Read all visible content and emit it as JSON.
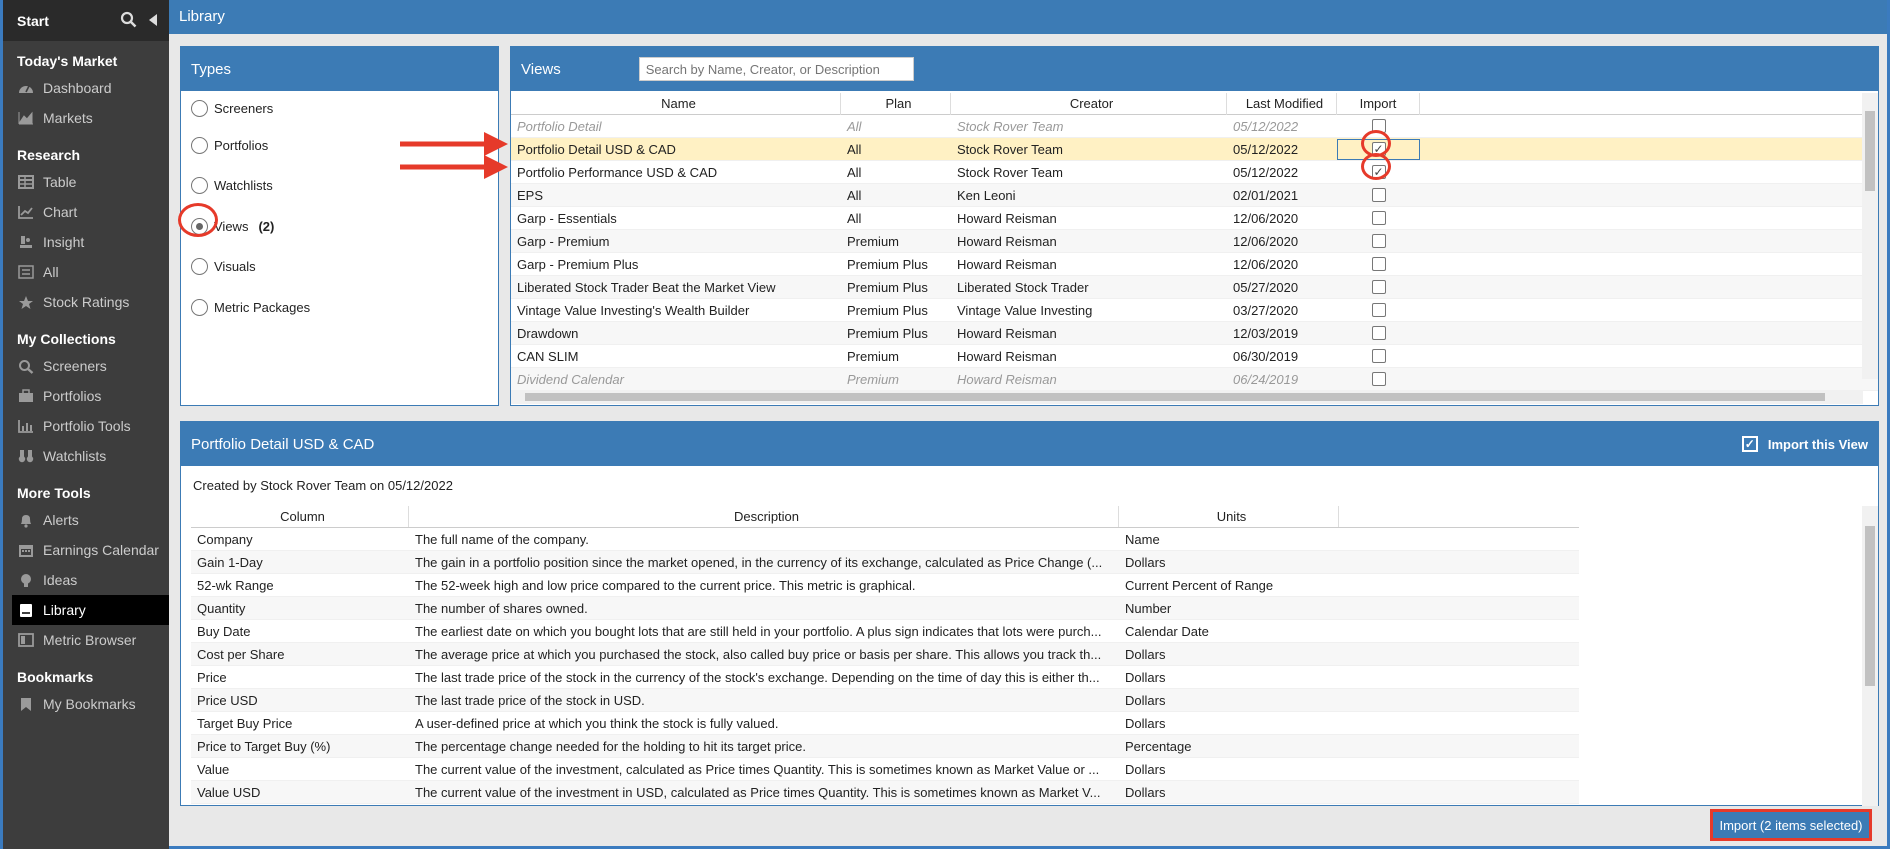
{
  "sidebar": {
    "start_label": "Start",
    "sections": [
      {
        "title": "Today's Market",
        "items": [
          {
            "label": "Dashboard",
            "icon": "dashboard-icon"
          },
          {
            "label": "Markets",
            "icon": "markets-icon"
          }
        ]
      },
      {
        "title": "Research",
        "items": [
          {
            "label": "Table",
            "icon": "table-icon"
          },
          {
            "label": "Chart",
            "icon": "chart-icon"
          },
          {
            "label": "Insight",
            "icon": "insight-icon"
          },
          {
            "label": "All",
            "icon": "all-icon"
          },
          {
            "label": "Stock Ratings",
            "icon": "star-icon"
          }
        ]
      },
      {
        "title": "My Collections",
        "items": [
          {
            "label": "Screeners",
            "icon": "search-icon"
          },
          {
            "label": "Portfolios",
            "icon": "portfolio-icon"
          },
          {
            "label": "Portfolio Tools",
            "icon": "tools-icon"
          },
          {
            "label": "Watchlists",
            "icon": "binoculars-icon"
          }
        ]
      },
      {
        "title": "More Tools",
        "items": [
          {
            "label": "Alerts",
            "icon": "bell-icon"
          },
          {
            "label": "Earnings Calendar",
            "icon": "calendar-icon"
          },
          {
            "label": "Ideas",
            "icon": "lightbulb-icon"
          },
          {
            "label": "Library",
            "icon": "library-icon",
            "active": true
          },
          {
            "label": "Metric Browser",
            "icon": "metric-icon"
          }
        ]
      },
      {
        "title": "Bookmarks",
        "items": [
          {
            "label": "My Bookmarks",
            "icon": "bookmark-icon"
          }
        ]
      }
    ]
  },
  "topbar": {
    "title": "Library"
  },
  "types": {
    "title": "Types",
    "items": [
      {
        "label": "Screeners",
        "count": ""
      },
      {
        "label": "Portfolios",
        "count": ""
      },
      {
        "label": "Watchlists",
        "count": ""
      },
      {
        "label": "Views",
        "count": "(2)",
        "selected": true
      },
      {
        "label": "Visuals",
        "count": ""
      },
      {
        "label": "Metric Packages",
        "count": ""
      }
    ]
  },
  "views": {
    "title": "Views",
    "search_placeholder": "Search by Name, Creator, or Description",
    "columns": [
      "Name",
      "Plan",
      "Creator",
      "Last Modified",
      "Import"
    ],
    "rows": [
      {
        "name": "Portfolio Detail",
        "plan": "All",
        "creator": "Stock Rover Team",
        "modified": "05/12/2022",
        "checked": false,
        "dim": true
      },
      {
        "name": "Portfolio Detail USD & CAD",
        "plan": "All",
        "creator": "Stock Rover Team",
        "modified": "05/12/2022",
        "checked": true,
        "highlight": true
      },
      {
        "name": "Portfolio Performance USD & CAD",
        "plan": "All",
        "creator": "Stock Rover Team",
        "modified": "05/12/2022",
        "checked": true
      },
      {
        "name": "EPS",
        "plan": "All",
        "creator": "Ken Leoni",
        "modified": "02/01/2021",
        "checked": false
      },
      {
        "name": "Garp - Essentials",
        "plan": "All",
        "creator": "Howard Reisman",
        "modified": "12/06/2020",
        "checked": false
      },
      {
        "name": "Garp - Premium",
        "plan": "Premium",
        "creator": "Howard Reisman",
        "modified": "12/06/2020",
        "checked": false
      },
      {
        "name": "Garp - Premium Plus",
        "plan": "Premium Plus",
        "creator": "Howard Reisman",
        "modified": "12/06/2020",
        "checked": false
      },
      {
        "name": "Liberated Stock Trader Beat the Market View",
        "plan": "Premium Plus",
        "creator": "Liberated Stock Trader",
        "modified": "05/27/2020",
        "checked": false
      },
      {
        "name": "Vintage Value Investing's Wealth Builder",
        "plan": "Premium Plus",
        "creator": "Vintage Value Investing",
        "modified": "03/27/2020",
        "checked": false
      },
      {
        "name": "Drawdown",
        "plan": "Premium Plus",
        "creator": "Howard Reisman",
        "modified": "12/03/2019",
        "checked": false
      },
      {
        "name": "CAN SLIM",
        "plan": "Premium",
        "creator": "Howard Reisman",
        "modified": "06/30/2019",
        "checked": false
      },
      {
        "name": "Dividend Calendar",
        "plan": "Premium",
        "creator": "Howard Reisman",
        "modified": "06/24/2019",
        "checked": false,
        "dim": true
      }
    ]
  },
  "detail": {
    "title": "Portfolio Detail USD & CAD",
    "import_view_label": "Import this View",
    "created_text": "Created by Stock Rover Team on 05/12/2022",
    "columns": [
      "Column",
      "Description",
      "Units"
    ],
    "rows": [
      {
        "col": "Company",
        "desc": "The full name of the company.",
        "units": "Name"
      },
      {
        "col": "Gain 1-Day",
        "desc": "The gain in a portfolio position since the market opened, in the currency of its exchange, calculated as Price Change (...",
        "units": "Dollars"
      },
      {
        "col": "52-wk Range",
        "desc": "The 52-week high and low price compared to the current price. This metric is graphical.",
        "units": "Current Percent of Range"
      },
      {
        "col": "Quantity",
        "desc": "The number of shares owned.",
        "units": "Number"
      },
      {
        "col": "Buy Date",
        "desc": "The earliest date on which you bought lots that are still held in your portfolio. A plus sign indicates that lots were purch...",
        "units": "Calendar Date"
      },
      {
        "col": "Cost per Share",
        "desc": "The average price at which you purchased the stock, also called buy price or basis per share. This allows you track th...",
        "units": "Dollars"
      },
      {
        "col": "Price",
        "desc": "The last trade price of the stock in the currency of the stock's exchange. Depending on the time of day this is either th...",
        "units": "Dollars"
      },
      {
        "col": "Price USD",
        "desc": "The last trade price of the stock in USD.",
        "units": "Dollars"
      },
      {
        "col": "Target Buy Price",
        "desc": "A user-defined price at which you think the stock is fully valued.",
        "units": "Dollars"
      },
      {
        "col": "Price to Target Buy (%)",
        "desc": "The percentage change needed for the holding to hit its target price.",
        "units": "Percentage"
      },
      {
        "col": "Value",
        "desc": "The current value of the investment, calculated as Price times Quantity. This is sometimes known as Market Value or ...",
        "units": "Dollars"
      },
      {
        "col": "Value USD",
        "desc": "The current value of the investment in USD, calculated as Price times Quantity. This is sometimes known as Market V...",
        "units": "Dollars"
      }
    ]
  },
  "import_button": {
    "label": "Import (2 items selected)"
  },
  "colors": {
    "accent": "#3c7bb5",
    "annotation": "#e63a2a",
    "highlight": "#fff1c4",
    "sidebar": "#3d3d3d"
  }
}
